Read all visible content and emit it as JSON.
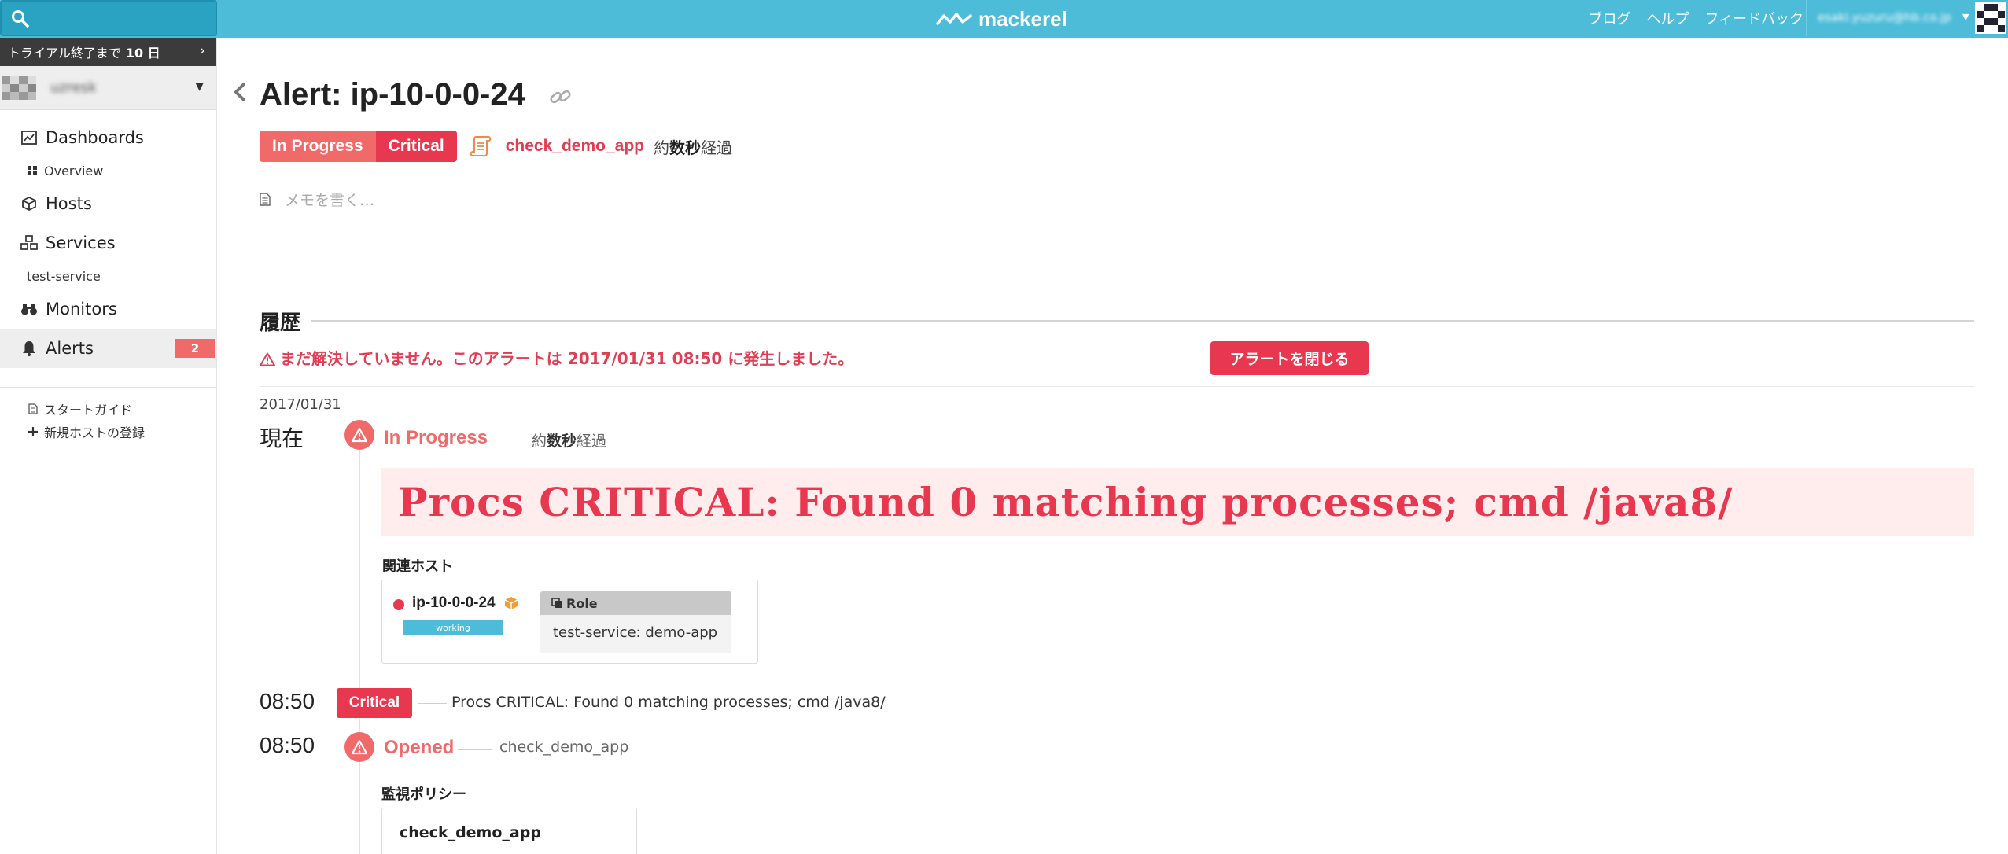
{
  "topbar": {
    "brand": "mackerel",
    "links": [
      "ブログ",
      "ヘルプ",
      "フィードバック"
    ],
    "user_email": "esaki.yuzuru@hb.co.jp"
  },
  "sidebar": {
    "trial_prefix": "トライアル終了まで",
    "trial_days": "10 日",
    "org_name": "uzresk",
    "nav": {
      "dashboards": "Dashboards",
      "overview": "Overview",
      "hosts": "Hosts",
      "services": "Services",
      "service_item": "test-service",
      "monitors": "Monitors",
      "alerts": "Alerts",
      "alerts_count": "2"
    },
    "footer_links": [
      "スタートガイド",
      "新規ホストの登録"
    ]
  },
  "alert": {
    "title": "Alert: ip-10-0-0-24",
    "status": "In Progress",
    "severity": "Critical",
    "monitor_name": "check_demo_app",
    "elapsed_prefix": "約",
    "elapsed_value": "数秒",
    "elapsed_suffix": "経過",
    "memo_placeholder": "メモを書く…"
  },
  "history": {
    "title": "履歴",
    "warning": "まだ解決していません。このアラートは",
    "warning_date": "2017/01/31 08:50",
    "warning_suffix": "に発生しました。",
    "close_button": "アラートを閉じる",
    "date": "2017/01/31",
    "events": {
      "now": {
        "time": "現在",
        "label": "In Progress",
        "elapsed_prefix": "約",
        "elapsed_value": "数秒",
        "elapsed_suffix": "経過",
        "message": "Procs CRITICAL: Found 0 matching processes; cmd /java8/",
        "related_hosts_label": "関連ホスト",
        "host": {
          "name": "ip-10-0-0-24",
          "status": "working",
          "role_header": "Role",
          "role": "test-service: demo-app"
        }
      },
      "critical": {
        "time": "08:50",
        "label": "Critical",
        "message": "Procs CRITICAL: Found 0 matching processes; cmd /java8/"
      },
      "opened": {
        "time": "08:50",
        "label": "Opened",
        "monitor": "check_demo_app",
        "policy_label": "監視ポリシー",
        "policy_name": "check_demo_app"
      }
    }
  },
  "colors": {
    "topbar": "#4dbcd9",
    "critical": "#e8384f",
    "in_progress": "#f06a6a",
    "message_bg": "#ffeded"
  }
}
